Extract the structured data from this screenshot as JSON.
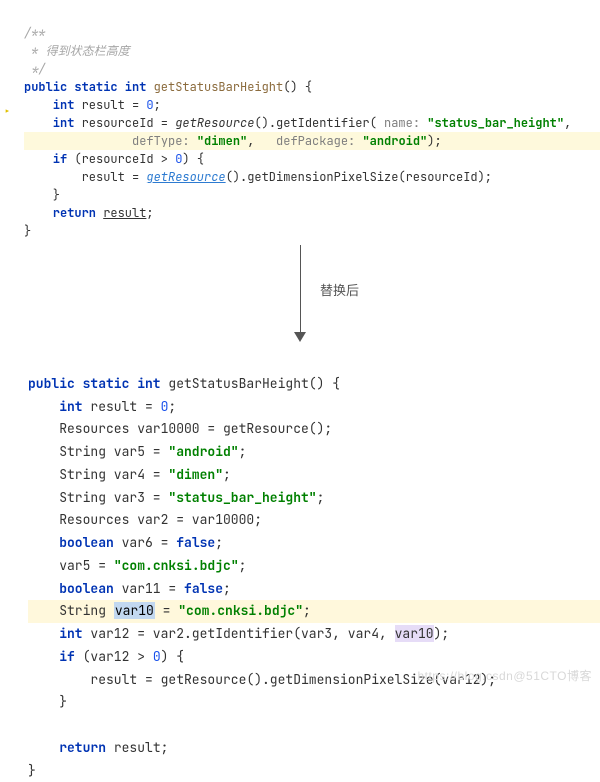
{
  "top": {
    "c1": "/**",
    "c2": " * 得到状态栏高度",
    "c3": " */",
    "l1a": "public static int ",
    "l1b": "getStatusBarHeight",
    "l1c": "() {",
    "l2a": "    int ",
    "l2b": "result = ",
    "l2c": "0",
    "l2d": ";",
    "l3a": "    int ",
    "l3b": "resourceId = ",
    "l3c": "getResource",
    "l3d": "().getIdentifier( ",
    "l3e": "name:",
    "l3f": " \"status_bar_height\"",
    "l3g": ",",
    "l4a": "               ",
    "l4b": "defType:",
    "l4c": " \"dimen\"",
    "l4d": ",   ",
    "l4e": "defPackage:",
    "l4f": " \"android\"",
    "l4g": ");",
    "l5a": "    if ",
    "l5b": "(resourceId > ",
    "l5c": "0",
    "l5d": ") {",
    "l6a": "        result = ",
    "l6b": "getResource",
    "l6c": "().getDimensionPixelSize(resourceId);",
    "l7": "    }",
    "l8a": "    return ",
    "l8b": "result",
    "l8c": ";",
    "l9": "}"
  },
  "arrow_label": "替换后",
  "bottom": {
    "l1a": "public static int ",
    "l1b": "getStatusBarHeight() {",
    "l2a": "    int ",
    "l2b": "result = ",
    "l2c": "0",
    "l2d": ";",
    "l3": "    Resources var10000 = getResource();",
    "l4a": "    String var5 = ",
    "l4b": "\"android\"",
    "l4c": ";",
    "l5a": "    String var4 = ",
    "l5b": "\"dimen\"",
    "l5c": ";",
    "l6a": "    String var3 = ",
    "l6b": "\"status_bar_height\"",
    "l6c": ";",
    "l7": "    Resources var2 = var10000;",
    "l8a": "    boolean ",
    "l8b": "var6 = ",
    "l8c": "false",
    "l8d": ";",
    "l9a": "    var5 = ",
    "l9b": "\"com.cnksi.bdjc\"",
    "l9c": ";",
    "l10a": "    boolean ",
    "l10b": "var11 = ",
    "l10c": "false",
    "l10d": ";",
    "l11a": "    String ",
    "l11b": "var10",
    "l11c": " = ",
    "l11d": "\"com.cnksi.bdjc\"",
    "l11e": ";",
    "l12a": "    int ",
    "l12b": "var12 = var2.getIdentifier(var3, var4, ",
    "l12c": "var10",
    "l12d": ");",
    "l13a": "    if ",
    "l13b": "(var12 > ",
    "l13c": "0",
    "l13d": ") {",
    "l14": "        result = getResource().getDimensionPixelSize(var12);",
    "l15": "    }",
    "blank": "",
    "l16a": "    return ",
    "l16b": "result;",
    "l17": "}"
  },
  "watermark": "https://blog.csdn@51CTO博客"
}
